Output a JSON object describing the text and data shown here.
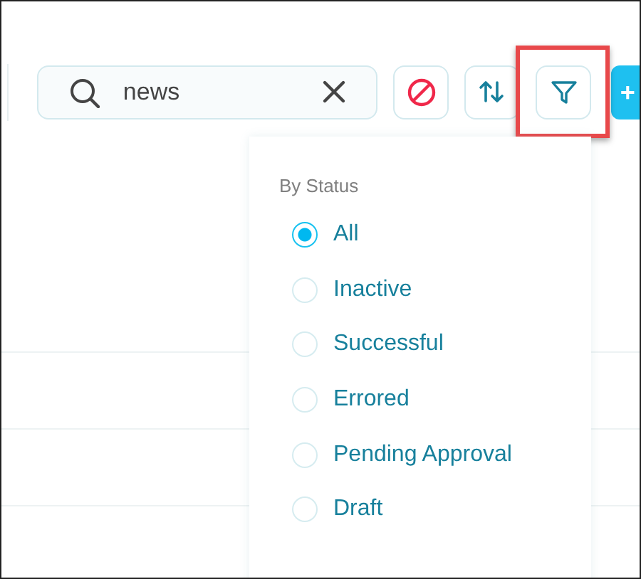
{
  "search": {
    "value": "news"
  },
  "toolbar": [
    {
      "kind": "block",
      "highlighted": false
    },
    {
      "kind": "sort",
      "highlighted": false
    },
    {
      "kind": "filter",
      "highlighted": true
    }
  ],
  "add_button": {
    "label": "+"
  },
  "filter_menu": {
    "heading": "By Status",
    "options": [
      {
        "label": "All",
        "selected": true
      },
      {
        "label": "Inactive",
        "selected": false
      },
      {
        "label": "Successful",
        "selected": false
      },
      {
        "label": "Errored",
        "selected": false
      },
      {
        "label": "Pending Approval",
        "selected": false
      },
      {
        "label": "Draft",
        "selected": false
      }
    ]
  }
}
